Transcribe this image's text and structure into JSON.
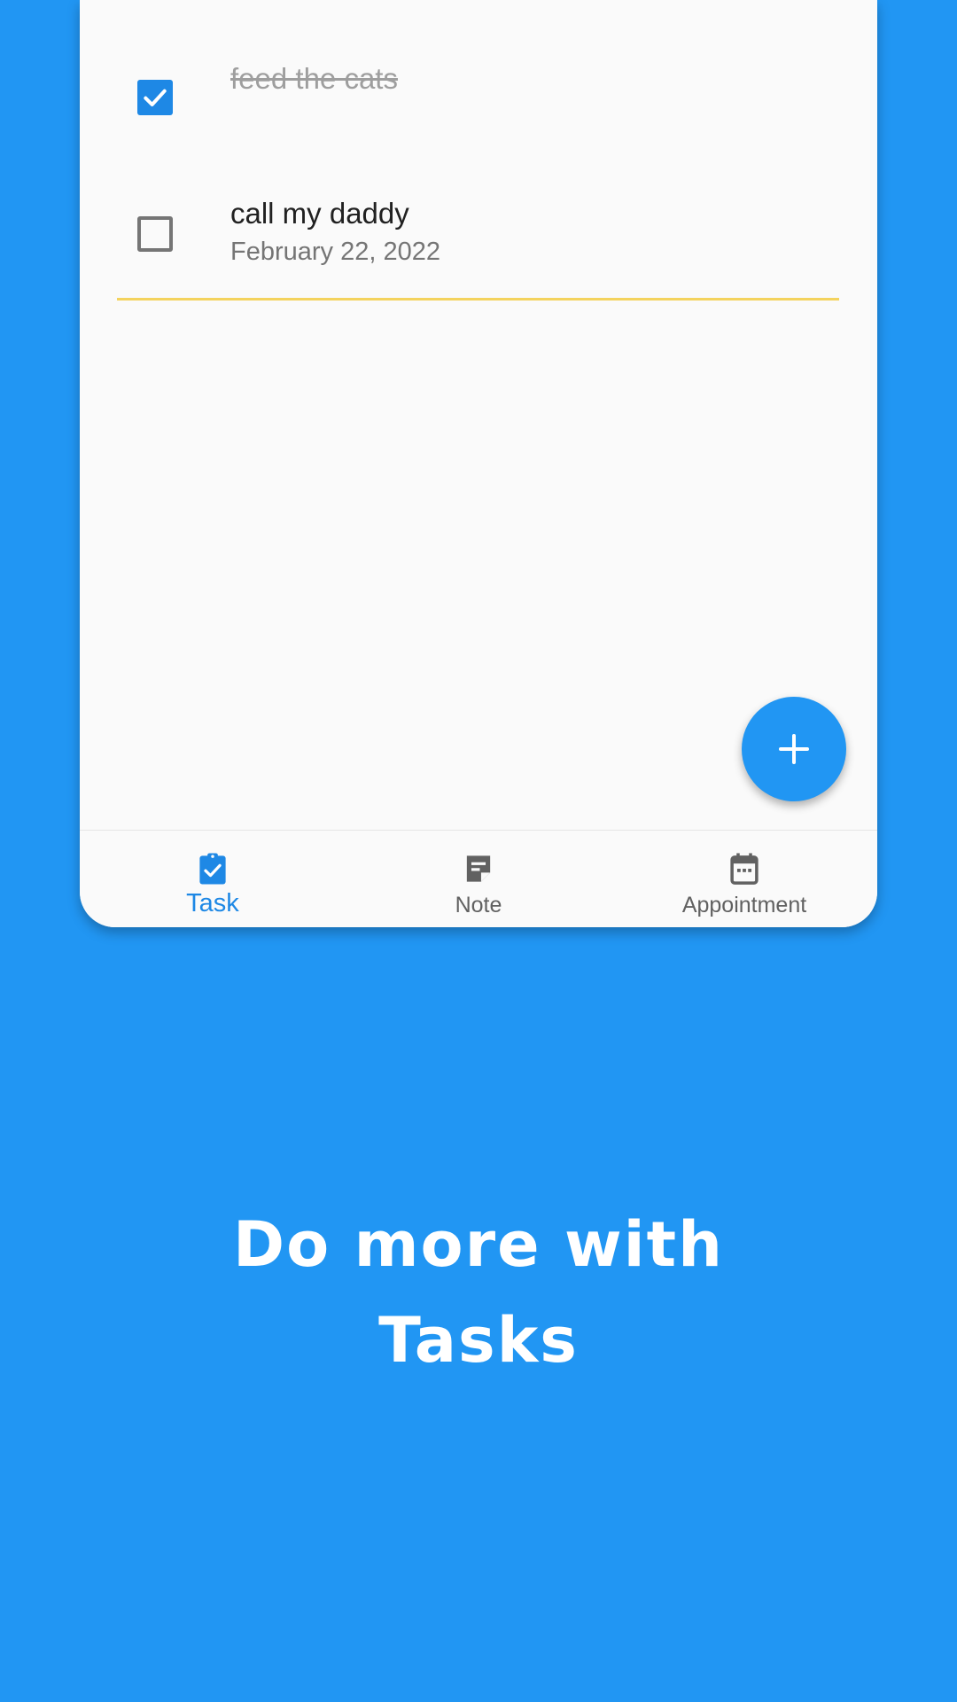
{
  "tasks": [
    {
      "title": "feed the cats",
      "checked": true,
      "date": ""
    },
    {
      "title": "call my daddy",
      "checked": false,
      "date": "February 22, 2022"
    }
  ],
  "fab": {
    "icon": "plus-icon"
  },
  "nav": {
    "items": [
      {
        "label": "Task",
        "icon": "task-check-icon",
        "active": true
      },
      {
        "label": "Note",
        "icon": "note-icon",
        "active": false
      },
      {
        "label": "Appointment",
        "icon": "calendar-icon",
        "active": false
      }
    ]
  },
  "promo": {
    "line1": "Do more with",
    "line2": "Tasks"
  },
  "colors": {
    "background": "#2196F3",
    "accent": "#1E88E5",
    "divider": "#F4D35E",
    "card": "#FAFAFA"
  }
}
